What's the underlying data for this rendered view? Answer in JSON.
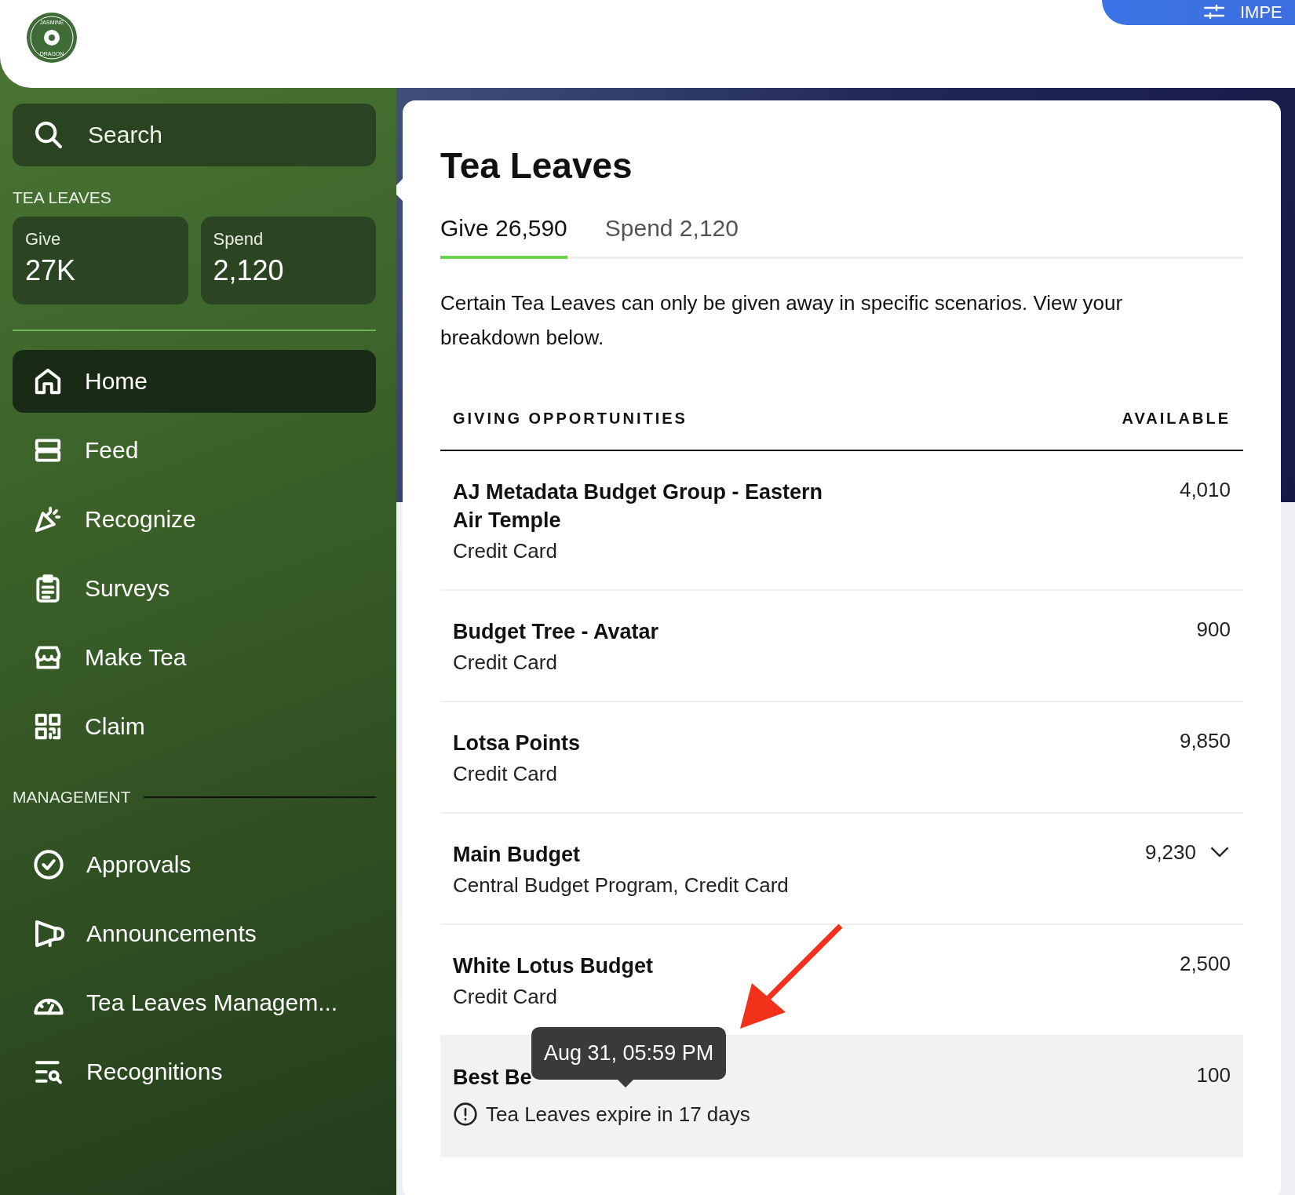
{
  "header": {
    "logo_text_top": "JASMINE",
    "logo_text_bottom": "DRAGON",
    "action_button": "IMPE"
  },
  "sidebar": {
    "search": {
      "placeholder": "Search"
    },
    "balance_heading": "TEA LEAVES",
    "balances": [
      {
        "label": "Give",
        "value": "27K"
      },
      {
        "label": "Spend",
        "value": "2,120"
      }
    ],
    "items": [
      {
        "label": "Home",
        "selected": true
      },
      {
        "label": "Feed",
        "selected": false
      },
      {
        "label": "Recognize",
        "selected": false
      },
      {
        "label": "Surveys",
        "selected": false
      },
      {
        "label": "Make Tea",
        "selected": false
      },
      {
        "label": "Claim",
        "selected": false
      }
    ],
    "management_heading": "MANAGEMENT",
    "management_items": [
      {
        "label": "Approvals",
        "selected": false
      },
      {
        "label": "Announcements",
        "selected": false
      },
      {
        "label": "Tea Leaves Managem...",
        "selected": false
      },
      {
        "label": "Recognitions",
        "selected": false
      }
    ]
  },
  "panel": {
    "title": "Tea Leaves",
    "tabs": [
      {
        "label": "Give 26,590",
        "selected": true
      },
      {
        "label": "Spend 2,120",
        "selected": false
      }
    ],
    "description": "Certain Tea Leaves can only be given away in specific scenarios. View your breakdown below.",
    "table": {
      "columns": [
        "GIVING OPPORTUNITIES",
        "AVAILABLE"
      ],
      "rows": [
        {
          "name": "AJ Metadata Budget Group - Eastern Air Temple",
          "detail": "Credit Card",
          "available": "4,010",
          "expandable": false,
          "highlighted": false
        },
        {
          "name": "Budget Tree - Avatar",
          "detail": "Credit Card",
          "available": "900",
          "expandable": false,
          "highlighted": false
        },
        {
          "name": "Lotsa Points",
          "detail": "Credit Card",
          "available": "9,850",
          "expandable": false,
          "highlighted": false
        },
        {
          "name": "Main Budget",
          "detail": "Central Budget Program, Credit Card",
          "available": "9,230",
          "expandable": true,
          "highlighted": false
        },
        {
          "name": "White Lotus Budget",
          "detail": "Credit Card",
          "available": "2,500",
          "expandable": false,
          "highlighted": false
        },
        {
          "name": "Best Be",
          "warning": "Tea Leaves expire in 17 days",
          "available": "100",
          "expandable": false,
          "highlighted": true,
          "tooltip": "Aug 31, 05:59 PM"
        }
      ]
    }
  }
}
